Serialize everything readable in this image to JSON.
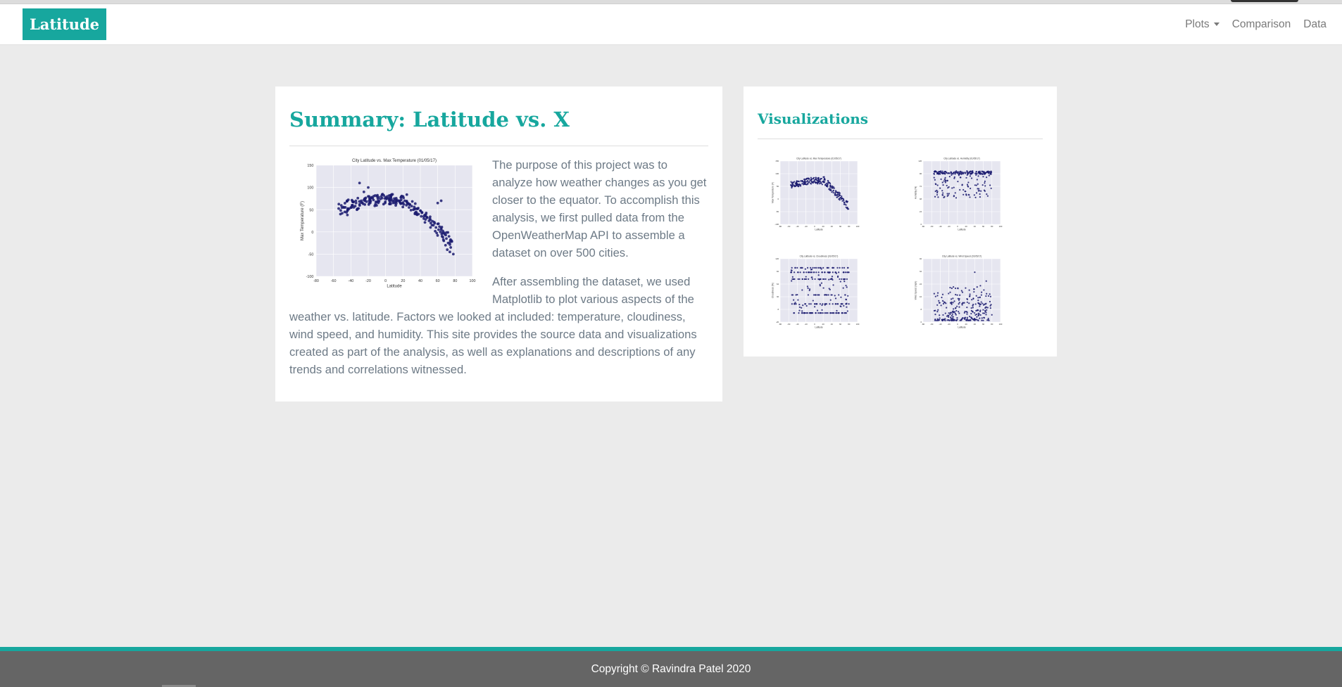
{
  "navbar": {
    "brand": "Latitude",
    "links": [
      {
        "label": "Plots"
      },
      {
        "label": "Comparison"
      },
      {
        "label": "Data"
      }
    ]
  },
  "summary": {
    "title": "Summary: Latitude vs. X",
    "paragraph1": "The purpose of this project was to analyze how weather changes as you get closer to the equator. To accomplish this analysis, we first pulled data from the OpenWeatherMap API to assemble a dataset on over 500 cities.",
    "paragraph2": "After assembling the dataset, we used Matplotlib to plot various aspects of the weather vs. latitude. Factors we looked at included: temperature, cloudiness, wind speed, and humidity. This site provides the source data and visualizations created as part of the analysis, as well as explanations and descriptions of any trends and correlations witnessed."
  },
  "chart_data": [
    {
      "type": "scatter",
      "title": "City Latitude vs. Max Temperature (01/05/17)",
      "xlabel": "Latitude",
      "ylabel": "Max Temperature (F)",
      "xlim": [
        -80,
        100
      ],
      "ylim": [
        -100,
        150
      ],
      "xticks": [
        -80,
        -60,
        -40,
        -20,
        0,
        20,
        40,
        60,
        80,
        100
      ],
      "yticks": [
        -100,
        -50,
        0,
        50,
        100,
        150
      ],
      "grid": true,
      "color": "#1a1a6e",
      "x": [
        -52,
        -50,
        -47,
        -45,
        -42,
        -40,
        -38,
        -35,
        -34,
        -33,
        -30,
        -28,
        -27,
        -25,
        -24,
        -22,
        -20,
        -19,
        -18,
        -16,
        -15,
        -14,
        -12,
        -10,
        -9,
        -8,
        -6,
        -5,
        -4,
        -2,
        0,
        1,
        2,
        4,
        5,
        6,
        8,
        10,
        12,
        13,
        15,
        17,
        18,
        20,
        21,
        22,
        24,
        25,
        27,
        28,
        30,
        32,
        33,
        35,
        36,
        38,
        40,
        41,
        42,
        44,
        45,
        46,
        48,
        50,
        51,
        52,
        54,
        55,
        56,
        58,
        60,
        61,
        62,
        63,
        64,
        65,
        66,
        67,
        68,
        69,
        70,
        71,
        72,
        73,
        74,
        75,
        76,
        78,
        60,
        64,
        -30,
        -20,
        -25,
        -44
      ],
      "y": [
        40,
        42,
        45,
        44,
        52,
        55,
        60,
        58,
        65,
        50,
        62,
        70,
        66,
        72,
        75,
        68,
        80,
        70,
        74,
        78,
        76,
        72,
        82,
        80,
        75,
        78,
        74,
        80,
        76,
        82,
        78,
        74,
        80,
        76,
        72,
        78,
        70,
        75,
        68,
        72,
        70,
        65,
        72,
        66,
        62,
        70,
        60,
        64,
        55,
        62,
        58,
        50,
        56,
        45,
        52,
        40,
        48,
        35,
        44,
        30,
        38,
        28,
        32,
        25,
        30,
        20,
        24,
        15,
        22,
        10,
        18,
        5,
        12,
        0,
        8,
        -10,
        2,
        -20,
        -5,
        -30,
        -15,
        -40,
        -25,
        -10,
        -45,
        -35,
        -20,
        -50,
        65,
        70,
        110,
        100,
        90,
        38
      ],
      "extra_points": 150
    },
    {
      "type": "scatter",
      "title": "City Latitude vs. Max Temperature (01/05/17)",
      "xlabel": "Latitude",
      "ylabel": "Max Temperature (F)",
      "pattern": "arch",
      "xlim": [
        -80,
        100
      ],
      "ylim": [
        -100,
        150
      ],
      "color": "#1a1a6e"
    },
    {
      "type": "scatter",
      "title": "City Latitude vs. Humidity (01/05/17)",
      "xlabel": "Latitude",
      "ylabel": "Humidity (%)",
      "pattern": "humidity",
      "xlim": [
        -80,
        100
      ],
      "ylim": [
        0,
        120
      ],
      "color": "#1a1a6e"
    },
    {
      "type": "scatter",
      "title": "City Latitude vs. Cloudiness (01/05/17)",
      "xlabel": "Latitude",
      "ylabel": "Cloudiness (%)",
      "pattern": "bands",
      "xlim": [
        -80,
        100
      ],
      "ylim": [
        -20,
        120
      ],
      "color": "#1a1a6e"
    },
    {
      "type": "scatter",
      "title": "City Latitude vs. Wind Speed (01/05/17)",
      "xlabel": "Latitude",
      "ylabel": "Wind Speed (mph)",
      "pattern": "wind",
      "xlim": [
        -80,
        100
      ],
      "ylim": [
        0,
        40
      ],
      "color": "#1a1a6e"
    }
  ],
  "visualizations": {
    "title": "Visualizations"
  },
  "footer": {
    "text": "Copyright © Ravindra Patel 2020"
  },
  "colors": {
    "brand": "#17a79e",
    "background": "#ebebeb",
    "footer": "#656565"
  }
}
